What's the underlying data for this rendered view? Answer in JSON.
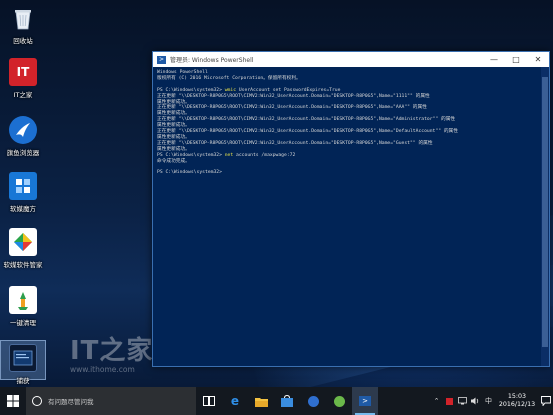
{
  "desktop_icons": [
    {
      "label": "回收站",
      "icon": "recycle-bin-icon"
    },
    {
      "label": "IT之家",
      "icon": "ithome-icon"
    },
    {
      "label": "旗鱼浏览器",
      "icon": "sailfish-browser-icon"
    },
    {
      "label": "软媒魔方",
      "icon": "ruanmei-mofang-icon"
    },
    {
      "label": "软媒软件管家",
      "icon": "software-manager-icon"
    },
    {
      "label": "一键清理",
      "icon": "one-click-clean-icon"
    },
    {
      "label": "捕获",
      "icon": "capture-icon"
    }
  ],
  "powershell": {
    "title": "管理员: Windows PowerShell",
    "header": [
      "Windows PowerShell",
      "版权所有 (C) 2016 Microsoft Corporation。保留所有权利。"
    ],
    "prompt1": "PS C:\\Windows\\system32> ",
    "cmd1_keyword": "wmic",
    "cmd1_args": " UserAccount set PasswordExpires=True",
    "output1": [
      "正在更新 \"\\\\DESKTOP-R8P0G5\\ROOT\\CIMV2:Win32_UserAccount.Domain=\"DESKTOP-R8P0G5\",Name=\"1111\"\" 的属性",
      "属性更新成功。",
      "正在更新 \"\\\\DESKTOP-R8P0G5\\ROOT\\CIMV2:Win32_UserAccount.Domain=\"DESKTOP-R8P0G5\",Name=\"AAA\"\" 的属性",
      "属性更新成功。",
      "正在更新 \"\\\\DESKTOP-R8P0G5\\ROOT\\CIMV2:Win32_UserAccount.Domain=\"DESKTOP-R8P0G5\",Name=\"Administrator\"\" 的属性",
      "属性更新成功。",
      "正在更新 \"\\\\DESKTOP-R8P0G5\\ROOT\\CIMV2:Win32_UserAccount.Domain=\"DESKTOP-R8P0G5\",Name=\"DefaultAccount\"\" 的属性",
      "属性更新成功。",
      "正在更新 \"\\\\DESKTOP-R8P0G5\\ROOT\\CIMV2:Win32_UserAccount.Domain=\"DESKTOP-R8P0G5\",Name=\"Guest\"\" 的属性",
      "属性更新成功。"
    ],
    "prompt2": "PS C:\\Windows\\system32> ",
    "cmd2_keyword": "net",
    "cmd2_args": " accounts /maxpwage:72",
    "output2": [
      "命令成功完成。"
    ],
    "prompt3": "PS C:\\Windows\\system32>"
  },
  "watermark": {
    "logo": "IT之家",
    "url": "www.ithome.com"
  },
  "taskbar": {
    "search_placeholder": "有问题尽管问我",
    "time": "15:03",
    "date": "2016/12/13"
  },
  "colors": {
    "console_bg": "#012456",
    "console_text": "#d8d8d8",
    "command_keyword": "#e8e24a",
    "taskbar_bg": "#13181f"
  }
}
